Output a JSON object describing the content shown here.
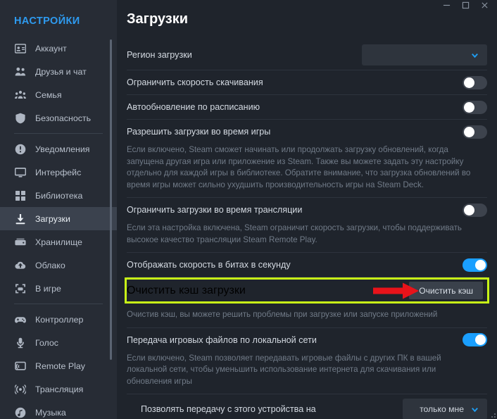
{
  "window": {
    "controls": [
      {
        "name": "minimize",
        "glyph": "minimize-icon"
      },
      {
        "name": "maximize",
        "glyph": "maximize-icon"
      },
      {
        "name": "close",
        "glyph": "close-icon"
      }
    ]
  },
  "sidebar": {
    "title": "НАСТРОЙКИ",
    "items": [
      {
        "label": "Аккаунт",
        "icon": "id-card-icon",
        "selected": false
      },
      {
        "label": "Друзья и чат",
        "icon": "two-people-icon",
        "selected": false
      },
      {
        "label": "Семья",
        "icon": "three-people-icon",
        "selected": false
      },
      {
        "label": "Безопасность",
        "icon": "shield-icon",
        "selected": false,
        "separator_after": true
      },
      {
        "label": "Уведомления",
        "icon": "exclamation-circle-icon",
        "selected": false
      },
      {
        "label": "Интерфейс",
        "icon": "monitor-icon",
        "selected": false
      },
      {
        "label": "Библиотека",
        "icon": "grid-icon",
        "selected": false
      },
      {
        "label": "Загрузки",
        "icon": "download-icon",
        "selected": true
      },
      {
        "label": "Хранилище",
        "icon": "hard-drive-icon",
        "selected": false
      },
      {
        "label": "Облако",
        "icon": "cloud-upload-icon",
        "selected": false
      },
      {
        "label": "В игре",
        "icon": "in-game-icon",
        "selected": false,
        "separator_after": true
      },
      {
        "label": "Контроллер",
        "icon": "gamepad-icon",
        "selected": false
      },
      {
        "label": "Голос",
        "icon": "microphone-icon",
        "selected": false
      },
      {
        "label": "Remote Play",
        "icon": "remote-play-icon",
        "selected": false
      },
      {
        "label": "Трансляция",
        "icon": "broadcast-icon",
        "selected": false
      },
      {
        "label": "Музыка",
        "icon": "music-note-icon",
        "selected": false
      }
    ]
  },
  "main": {
    "title": "Загрузки",
    "region": {
      "label": "Регион загрузки",
      "value": "",
      "placeholder": ""
    },
    "settings": {
      "limit_speed_label": "Ограничить скорость скачивания",
      "limit_speed_on": false,
      "auto_update_label": "Автообновление по расписанию",
      "auto_update_on": false,
      "downloads_during_game_label": "Разрешить загрузки во время игры",
      "downloads_during_game_on": false,
      "downloads_during_game_desc": "Если включено, Steam сможет начинать или продолжать загрузку обновлений, когда запущена другая игра или приложение из Steam. Также вы можете задать эту настройку отдельно для каждой игры в библиотеке. Обратите внимание, что загрузка обновлений во время игры может сильно ухудшить производительность игры на Steam Deck.",
      "limit_during_broadcast_label": "Ограничить загрузки во время трансляции",
      "limit_during_broadcast_on": false,
      "limit_during_broadcast_desc": "Если эта настройка включена, Steam ограничит скорость загрузки, чтобы поддерживать высокое качество трансляции Steam Remote Play.",
      "show_bits_label": "Отображать скорость в битах в секунду",
      "show_bits_on": true,
      "clear_cache_label": "Очистить кэш загрузки",
      "clear_cache_button": "Очистить кэш",
      "clear_cache_desc": "Очистив кэш, вы можете решить проблемы при загрузке или запуске приложений",
      "lan_transfer_label": "Передача игровых файлов по локальной сети",
      "lan_transfer_on": true,
      "lan_transfer_desc": "Если включено, Steam позволяет передавать игровые файлы с других ПК в вашей локальной сети, чтобы уменьшить использование интернета для скачивания или обновления игры",
      "allow_transfer_label": "Позволять передачу с этого устройства на",
      "allow_transfer_value": "только мне"
    }
  },
  "colors": {
    "accent_blue": "#1a9fff",
    "sidebar_title": "#2e9bf0",
    "highlight_green": "#c8f617",
    "arrow_red": "#e8131a",
    "background": "#1f242c",
    "sidebar_bg": "#272c35"
  }
}
